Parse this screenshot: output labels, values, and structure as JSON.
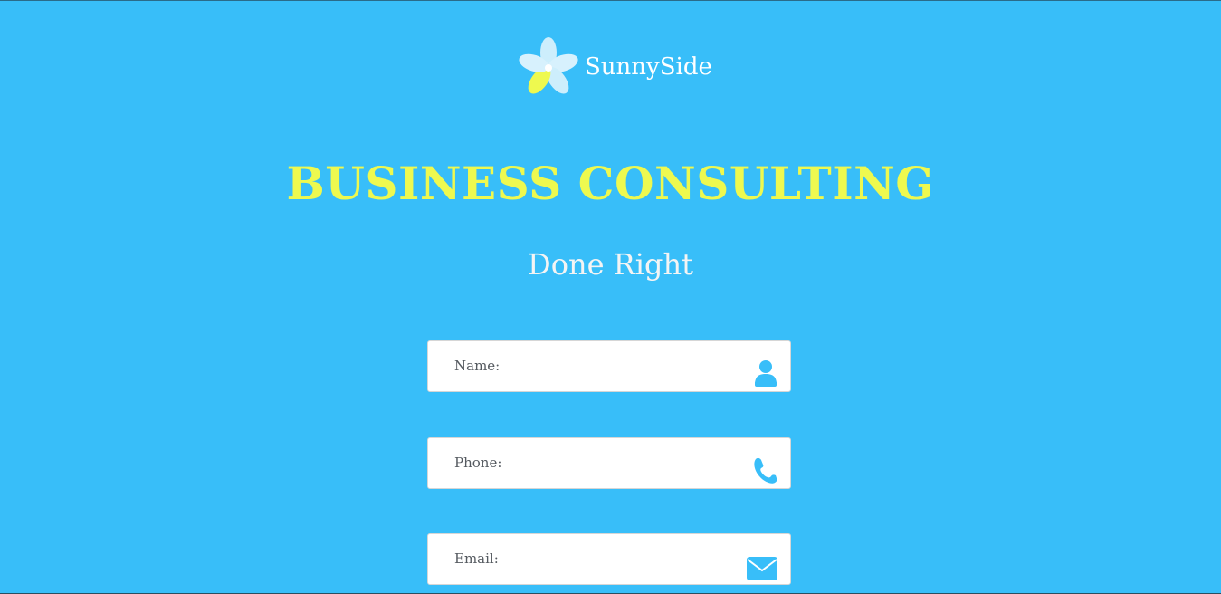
{
  "brand": {
    "name": "SunnySide",
    "logo_icon": "flower-icon"
  },
  "hero": {
    "headline": "BUSINESS CONSULTING",
    "subheadline": "Done Right"
  },
  "form": {
    "fields": [
      {
        "label": "Name:",
        "value": "",
        "icon": "user-icon"
      },
      {
        "label": "Phone:",
        "value": "",
        "icon": "phone-icon"
      },
      {
        "label": "Email:",
        "value": "",
        "icon": "envelope-icon"
      }
    ]
  },
  "colors": {
    "background": "#38bef9",
    "headline": "#eef94f",
    "icon_accent": "#38bef9",
    "field_background": "#ffffff"
  }
}
